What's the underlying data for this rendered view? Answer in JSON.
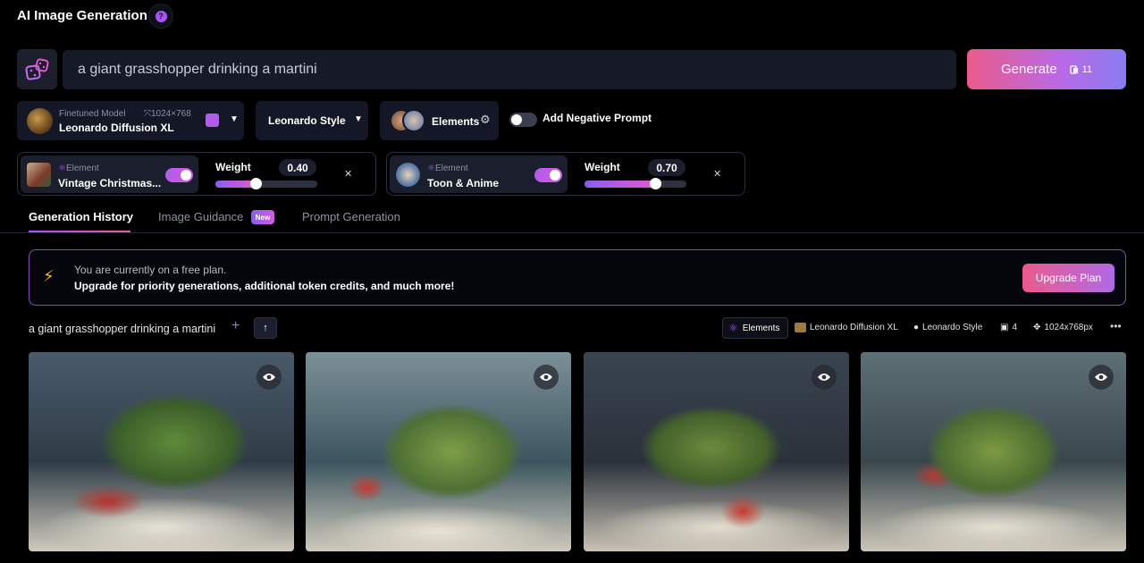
{
  "header": {
    "title": "AI Image Generation",
    "help_icon": "question-icon"
  },
  "prompt": {
    "value": "a giant grasshopper drinking a martini",
    "dice_icon": "dice-icon"
  },
  "generate": {
    "label": "Generate",
    "cost": "11"
  },
  "model": {
    "caption": "Finetuned Model",
    "resolution": "1024×768",
    "name": "Leonardo Diffusion XL"
  },
  "style": {
    "label": "Leonardo Style"
  },
  "elements_button": {
    "label": "Elements"
  },
  "negative_prompt": {
    "label": "Add Negative Prompt",
    "enabled": false
  },
  "element_panels": [
    {
      "caption": "Element",
      "name": "Vintage Christmas...",
      "enabled": true,
      "weight_label": "Weight",
      "weight": "0.40",
      "weight_fraction": 0.4
    },
    {
      "caption": "Element",
      "name": "Toon & Anime",
      "enabled": true,
      "weight_label": "Weight",
      "weight": "0.70",
      "weight_fraction": 0.7
    }
  ],
  "tabs": [
    {
      "label": "Generation History",
      "active": true
    },
    {
      "label": "Image Guidance",
      "badge": "New"
    },
    {
      "label": "Prompt Generation"
    }
  ],
  "banner": {
    "line1": "You are currently on a free plan.",
    "line2": "Upgrade for priority generations, additional token credits, and much more!",
    "button": "Upgrade Plan"
  },
  "generation": {
    "prompt": "a giant grasshopper drinking a martini",
    "tags": {
      "elements": "Elements",
      "model": "Leonardo Diffusion XL",
      "style": "Leonardo Style",
      "count": "4",
      "size": "1024x768px"
    }
  },
  "colors": {
    "accent": "#a855f7",
    "brand_gradient_start": "#ec5a8c",
    "brand_gradient_end": "#8a7bf2"
  }
}
